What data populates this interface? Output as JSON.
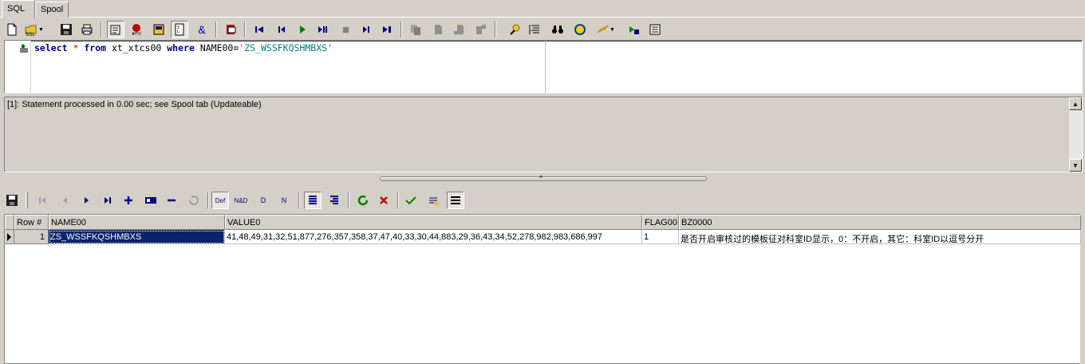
{
  "tabs": {
    "sql": "SQL",
    "spool": "Spool"
  },
  "editor": {
    "sql_select": "select",
    "sql_star": "*",
    "sql_from": "from",
    "sql_table": "xt_xtcs00",
    "sql_where": "where",
    "sql_col": "NAME00=",
    "sql_value": "'ZS_WSSFKQSHMBXS'"
  },
  "status": {
    "message": "[1]: Statement processed in 0.00 sec; see Spool tab (Updateable)"
  },
  "grid": {
    "headers": [
      "Row #",
      "NAME00",
      "VALUE0",
      "FLAG00",
      "BZ0000"
    ],
    "rows": [
      {
        "row_num": "1",
        "name00": "ZS_WSSFKQSHMBXS",
        "value0": "41,48,49,31,32,51,877,276,357,358,37,47,40,33,30,44,883,29,36,43,34,52,278,982,983,686,997",
        "flag00": "1",
        "bz0000": "是否开启审核过的模板征对科室ID显示，0：不开启，其它：科室ID以逗号分开"
      }
    ]
  },
  "icons": {
    "toolbar_top": [
      "new-icon",
      "open-sql-icon",
      "save-icon",
      "print-icon",
      "describe-icon",
      "stop-icon",
      "explain-icon",
      "sql-file-icon",
      "ampersand-icon",
      "paste-icon",
      "first-icon",
      "prev-icon",
      "run-icon",
      "run-step-icon",
      "stop-step-icon",
      "next-icon",
      "last-icon",
      "copy-icon",
      "cut-icon",
      "paste-doc-icon",
      "clear-icon",
      "tools-icon",
      "format-icon",
      "binoculars-icon",
      "help-icon",
      "lightning-icon",
      "connect-icon",
      "options-icon"
    ],
    "toolbar_grid": [
      "save-icon",
      "first-record-icon",
      "prev-record-icon",
      "next-record-icon",
      "last-record-icon",
      "insert-record-icon",
      "edit-record-icon",
      "delete-record-icon",
      "undo-icon",
      "def-icon",
      "nd-icon",
      "d-icon",
      "n-icon",
      "grid-view-icon",
      "form-view-icon",
      "refresh-icon",
      "cancel-icon",
      "commit-icon",
      "rollback-icon",
      "export-icon"
    ]
  },
  "colors": {
    "keyword": "#00008b",
    "string": "#008080",
    "selection": "#0a246a",
    "chrome": "#d4d0c8"
  }
}
